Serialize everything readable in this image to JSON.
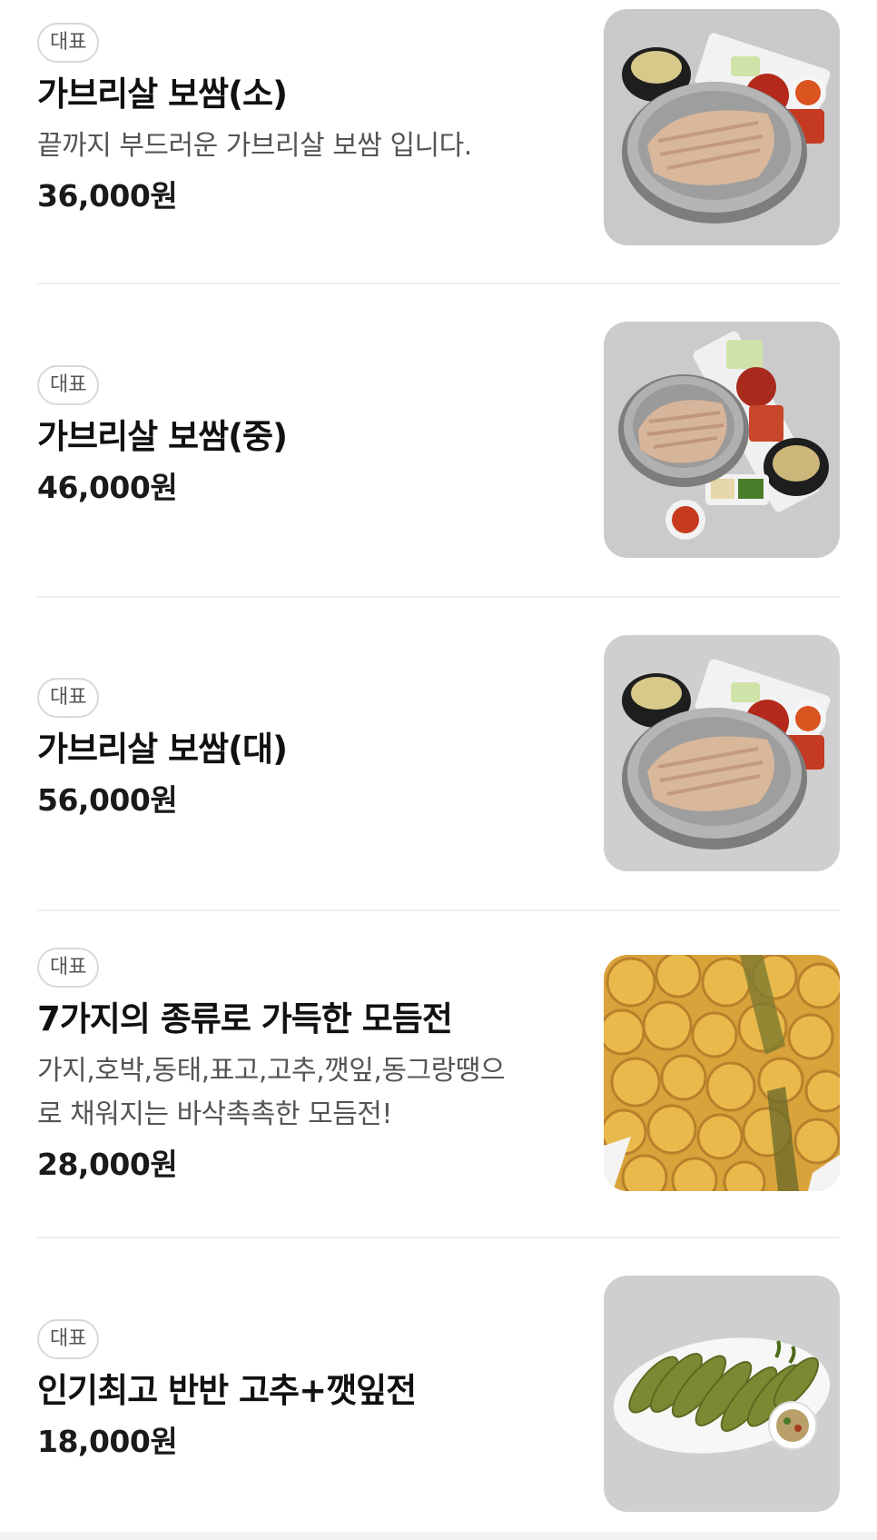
{
  "menu": {
    "items": [
      {
        "badge": "대표",
        "name": "가브리살 보쌈(소)",
        "description": "끝까지 부드러운 가브리살 보쌈 입니다.",
        "price": "36,000원",
        "image_icon": "bossam-photo"
      },
      {
        "badge": "대표",
        "name": "가브리살 보쌈(중)",
        "price": "46,000원",
        "image_icon": "bossam-photo"
      },
      {
        "badge": "대표",
        "name": "가브리살 보쌈(대)",
        "price": "56,000원",
        "image_icon": "bossam-photo"
      },
      {
        "badge": "대표",
        "name": "7가지의 종류로 가득한 모듬전",
        "description_lines": [
          "가지,호박,동태,표고,고추,깻잎,동그랑땡으",
          "로 채워지는 바삭촉촉한 모듬전!"
        ],
        "price": "28,000원",
        "image_icon": "jeon-photo"
      },
      {
        "badge": "대표",
        "name": "인기최고 반반 고추+깻잎전",
        "price": "18,000원",
        "image_icon": "pepper-perilla-jeon-photo"
      }
    ]
  },
  "colors": {
    "background": "#ffffff",
    "text_primary": "#111111",
    "text_secondary": "#555555",
    "badge_border": "#d8d8d8",
    "divider": "#f0f0f0"
  }
}
